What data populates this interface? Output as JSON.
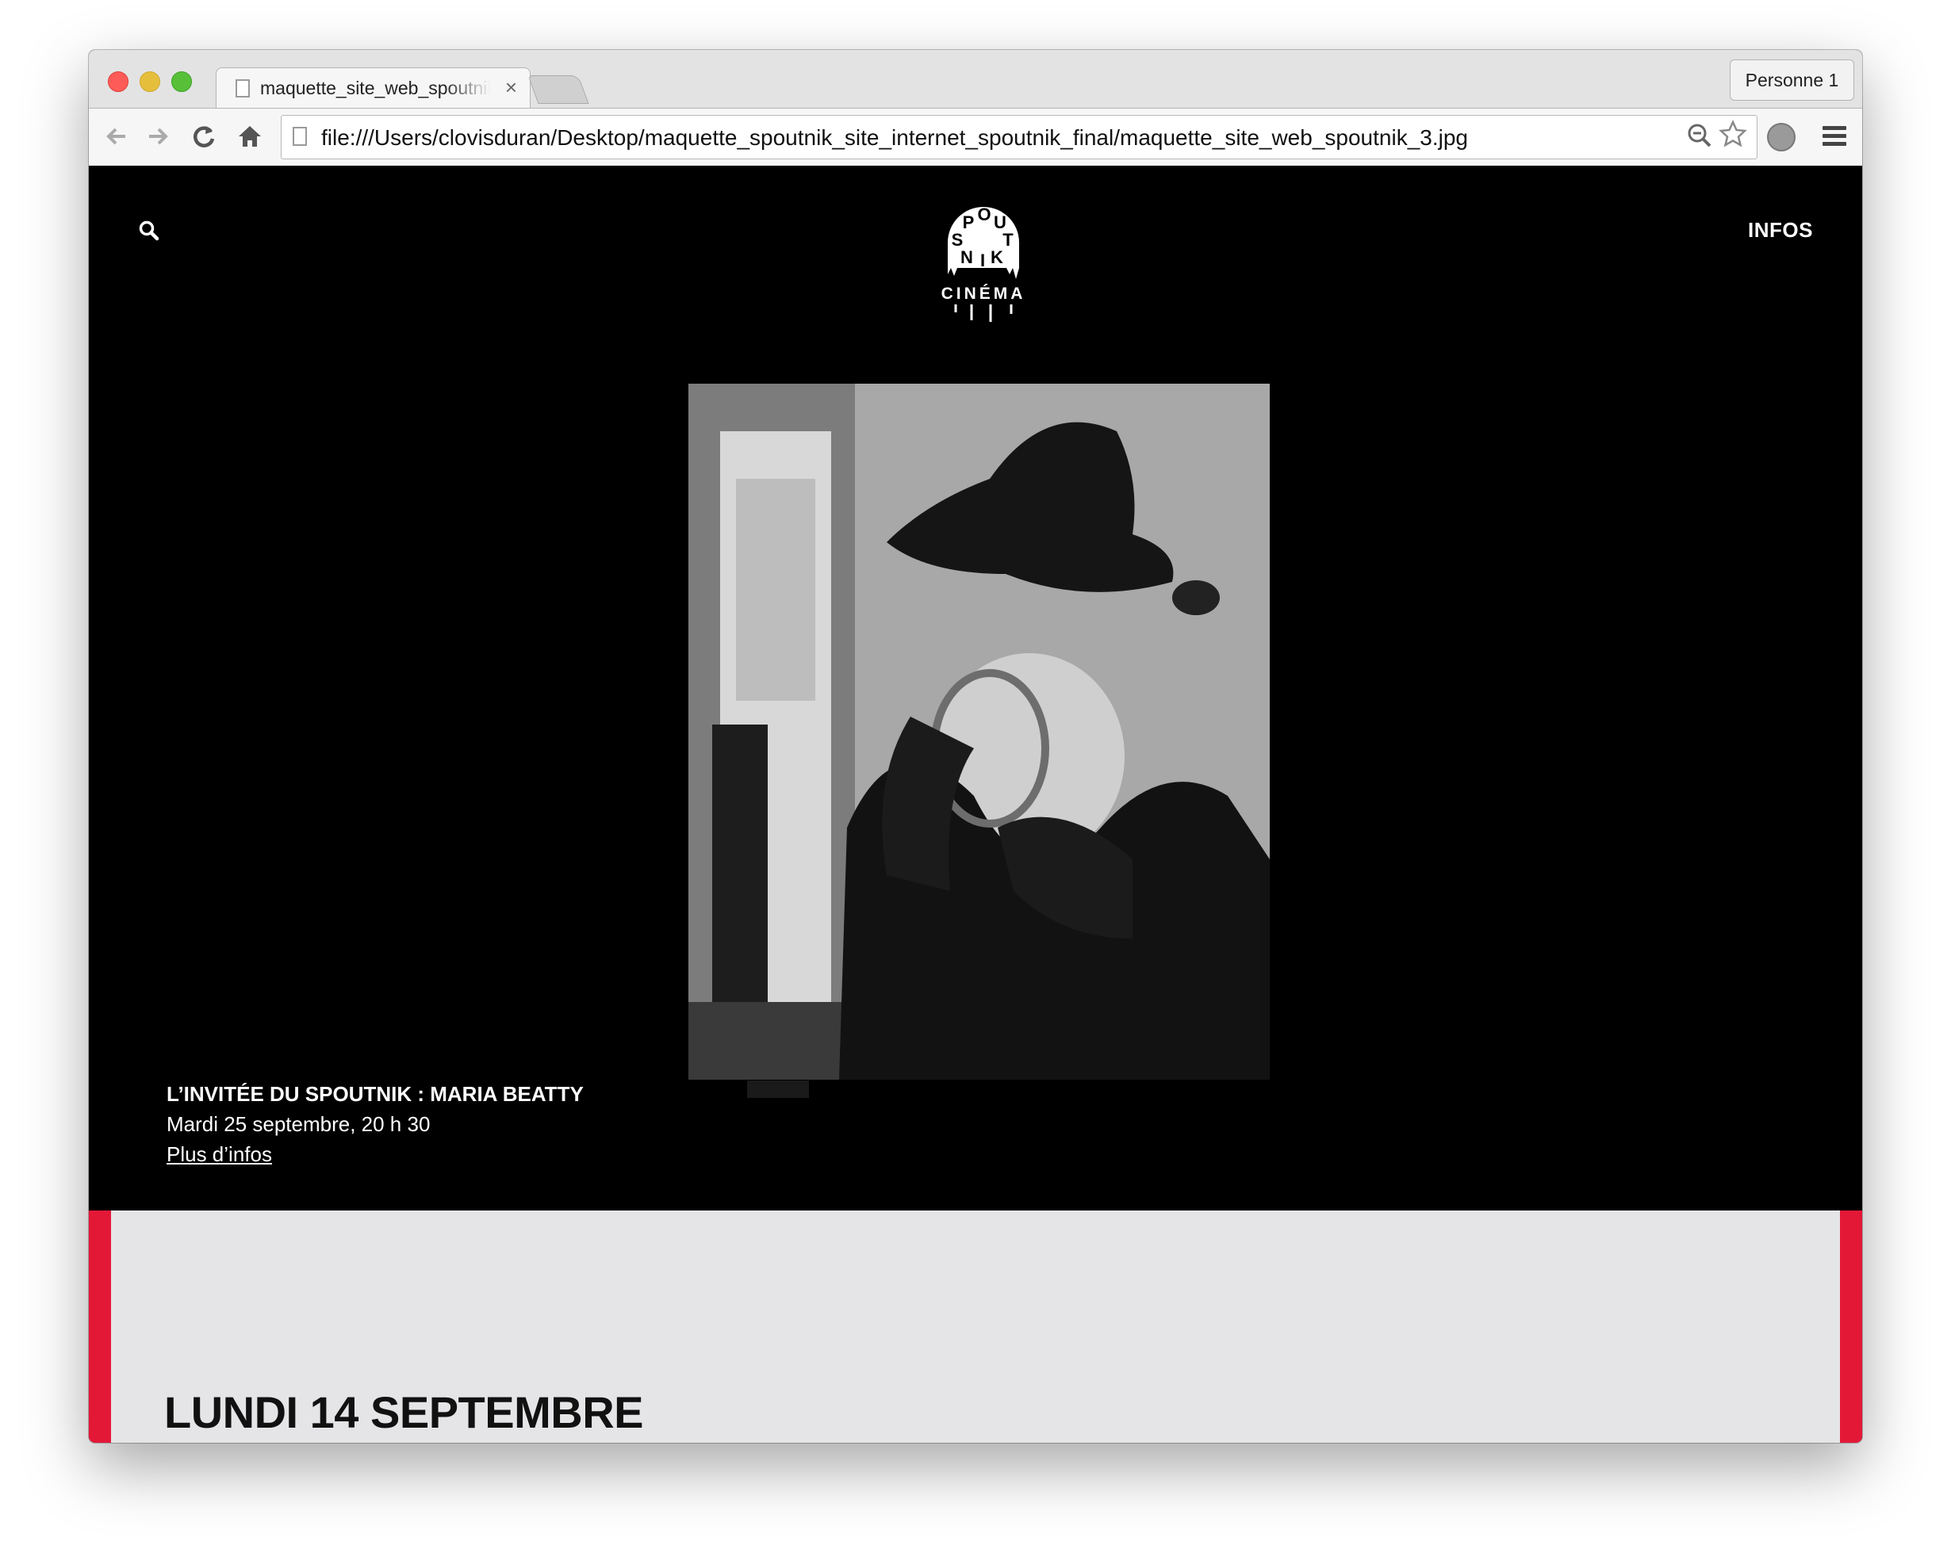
{
  "browser": {
    "tab_title": "maquette_site_web_spoutnik_3.jpg",
    "tab_close": "×",
    "profile_label": "Personne 1",
    "url": "file:///Users/clovisduran/Desktop/maquette_spoutnik_site_internet_spoutnik_final/maquette_site_web_spoutnik_3.jpg",
    "icons": {
      "back": "arrow-left-icon",
      "forward": "arrow-right-icon",
      "reload": "reload-icon",
      "home": "home-icon",
      "zoom": "zoom-icon",
      "bookmark": "star-icon",
      "extension": "extension-icon",
      "menu": "hamburger-menu-icon"
    }
  },
  "site": {
    "nav": {
      "infos_label": "INFOS",
      "search_icon": "search-icon"
    },
    "logo": {
      "letters": [
        "S",
        "P",
        "O",
        "U",
        "T",
        "N",
        "I",
        "K"
      ],
      "subtitle": "CINÉMA"
    },
    "hero": {
      "title": "L’INVITÉE DU SPOUTNIK : MARIA BEATTY",
      "date": "Mardi 25 septembre, 20 h 30",
      "link_label": "Plus d’infos"
    },
    "program": {
      "day_heading": "LUNDI 14 SEPTEMBRE"
    }
  },
  "colors": {
    "accent_red": "#e31837",
    "page_bg": "#000000",
    "program_bg": "#e5e5e8"
  }
}
